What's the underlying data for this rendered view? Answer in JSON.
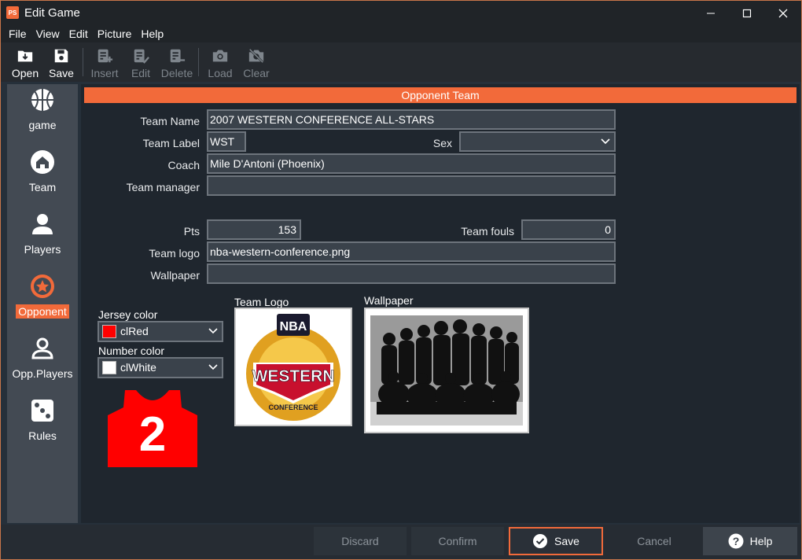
{
  "window": {
    "title": "Edit Game",
    "app_icon": "PS",
    "maximize_glyph": "☐",
    "close_glyph": "✕"
  },
  "menu": [
    "File",
    "View",
    "Edit",
    "Picture",
    "Help"
  ],
  "toolbar": {
    "open": "Open",
    "save": "Save",
    "insert": "Insert",
    "edit": "Edit",
    "delete": "Delete",
    "load": "Load",
    "clear": "Clear"
  },
  "sidebar": {
    "items": [
      {
        "label": "game",
        "icon": "basketball-icon"
      },
      {
        "label": "Team",
        "icon": "home-icon"
      },
      {
        "label": "Players",
        "icon": "person-icon"
      },
      {
        "label": "Opponent",
        "icon": "star-badge-icon",
        "active": true
      },
      {
        "label": "Opp.Players",
        "icon": "person-outline-icon"
      },
      {
        "label": "Rules",
        "icon": "dice-icon"
      }
    ]
  },
  "section_title": "Opponent Team",
  "form": {
    "team_name_label": "Team Name",
    "team_name": "2007 WESTERN CONFERENCE ALL-STARS",
    "team_label_label": "Team Label",
    "team_label": "WST",
    "sex_label": "Sex",
    "sex": "",
    "coach_label": "Coach",
    "coach": "Mile D'Antoni (Phoenix)",
    "manager_label": "Team manager",
    "manager": "",
    "pts_label": "Pts",
    "pts": "153",
    "fouls_label": "Team fouls",
    "fouls": "0",
    "logo_label": "Team logo",
    "logo": "nba-western-conference.png",
    "wallpaper_label": "Wallpaper",
    "wallpaper": ""
  },
  "colors_panel": {
    "jersey_label": "Jersey color",
    "jersey_value": "clRed",
    "jersey_hex": "#ff0000",
    "number_label": "Number color",
    "number_value": "clWhite",
    "number_hex": "#ffffff",
    "jersey_number": "2"
  },
  "images": {
    "logo_caption": "Team Logo",
    "wallpaper_caption": "Wallpaper",
    "logo_top_text": "NBA",
    "logo_main_text": "WESTERN",
    "logo_bottom_text": "CONFERENCE"
  },
  "footer": {
    "discard": "Discard",
    "confirm": "Confirm",
    "save": "Save",
    "cancel": "Cancel",
    "help": "Help"
  },
  "theme": {
    "accent": "#f26a3a",
    "panel": "#1f262e",
    "sidebar": "#434a53"
  }
}
